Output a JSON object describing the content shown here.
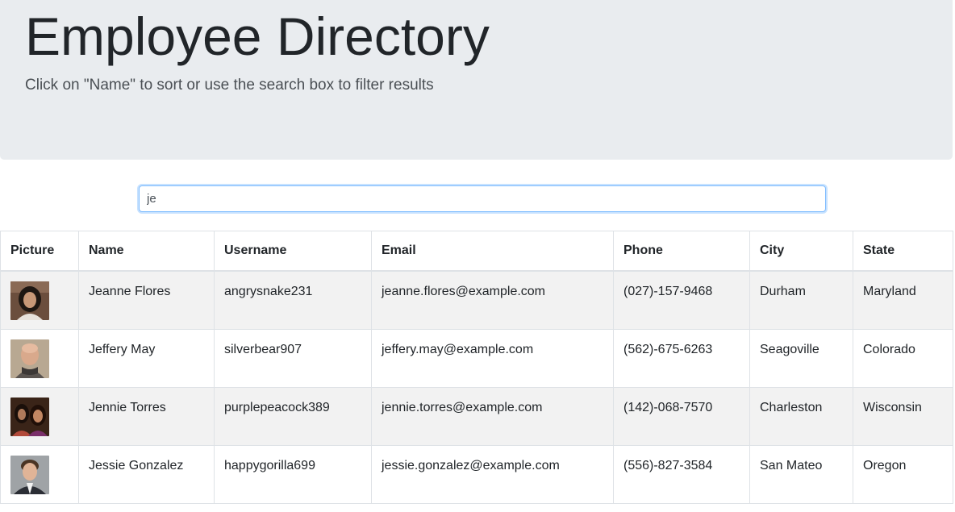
{
  "header": {
    "title": "Employee Directory",
    "subtitle": "Click on \"Name\" to sort or use the search box to filter results"
  },
  "search": {
    "value": "je",
    "placeholder": ""
  },
  "table": {
    "columns": [
      "Picture",
      "Name",
      "Username",
      "Email",
      "Phone",
      "City",
      "State"
    ],
    "rows": [
      {
        "picture": "avatar-woman-dark-hair",
        "name": "Jeanne Flores",
        "username": "angrysnake231",
        "email": "jeanne.flores@example.com",
        "phone": "(027)-157-9468",
        "city": "Durham",
        "state": "Maryland"
      },
      {
        "picture": "avatar-bald-man-scarf",
        "name": "Jeffery May",
        "username": "silverbear907",
        "email": "jeffery.may@example.com",
        "phone": "(562)-675-6263",
        "city": "Seagoville",
        "state": "Colorado"
      },
      {
        "picture": "avatar-two-women",
        "name": "Jennie Torres",
        "username": "purplepeacock389",
        "email": "jennie.torres@example.com",
        "phone": "(142)-068-7570",
        "city": "Charleston",
        "state": "Wisconsin"
      },
      {
        "picture": "avatar-man-suit",
        "name": "Jessie Gonzalez",
        "username": "happygorilla699",
        "email": "jessie.gonzalez@example.com",
        "phone": "(556)-827-3584",
        "city": "San Mateo",
        "state": "Oregon"
      }
    ]
  },
  "colors": {
    "jumbotron_bg": "#e9ecef",
    "striped_row": "#f2f2f2",
    "focus_border": "#80bdff"
  }
}
